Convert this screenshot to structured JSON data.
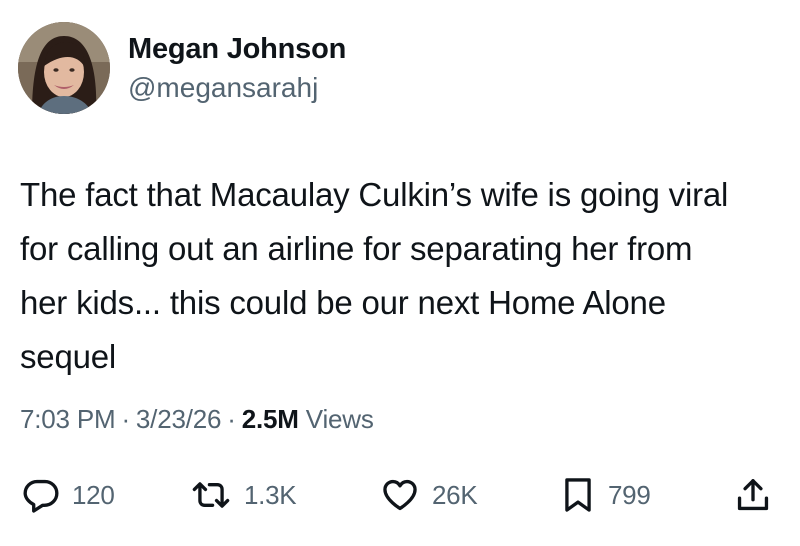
{
  "author": {
    "display_name": "Megan Johnson",
    "handle": "@megansarahj",
    "avatar_icon": "profile-photo"
  },
  "tweet": {
    "text_lines": [
      "The fact that Macaulay Culkin’s wife is going viral",
      "for calling out an airline for separating her from",
      "her kids...  this could be our next Home Alone",
      "sequel"
    ]
  },
  "meta": {
    "time": "7:03 PM",
    "separator": "·",
    "date": "3/23/26",
    "views_count": "2.5M",
    "views_label": "Views"
  },
  "actions": {
    "reply": {
      "icon": "reply-icon",
      "count": "120"
    },
    "repost": {
      "icon": "repost-icon",
      "count": "1.3K"
    },
    "like": {
      "icon": "heart-icon",
      "count": "26K"
    },
    "bookmark": {
      "icon": "bookmark-icon",
      "count": "799"
    },
    "share": {
      "icon": "share-icon"
    }
  },
  "colors": {
    "text_primary": "#0f1419",
    "text_secondary": "#536471",
    "background": "#ffffff"
  }
}
